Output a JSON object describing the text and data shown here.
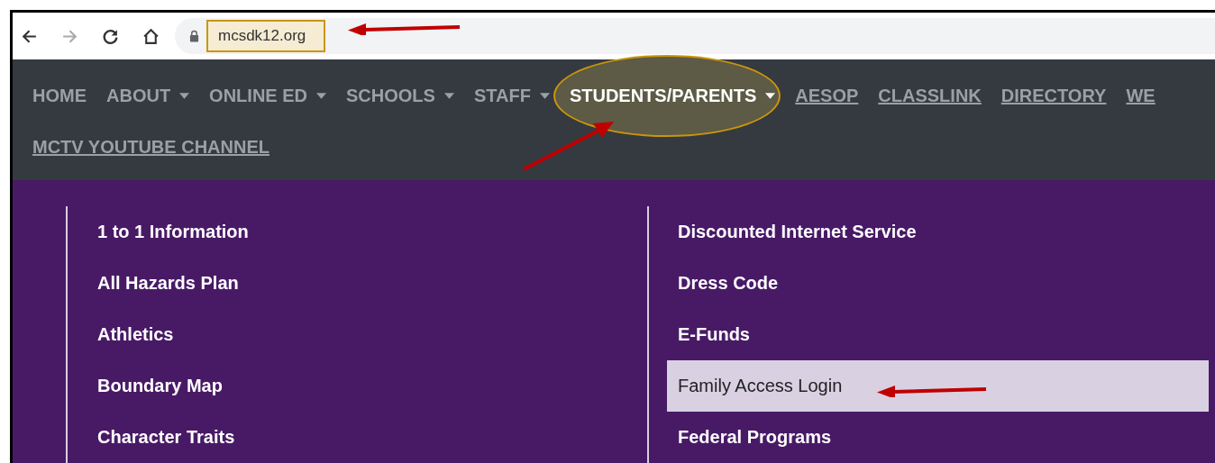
{
  "browser": {
    "back_disabled": false,
    "forward_disabled": true,
    "url": "mcsdk12.org"
  },
  "nav": {
    "rows": [
      [
        {
          "label": "HOME",
          "dropdown": false,
          "kind": "plain",
          "selected": false
        },
        {
          "label": "ABOUT",
          "dropdown": true,
          "kind": "plain",
          "selected": false
        },
        {
          "label": "ONLINE ED",
          "dropdown": true,
          "kind": "plain",
          "selected": false
        },
        {
          "label": "SCHOOLS",
          "dropdown": true,
          "kind": "plain",
          "selected": false
        },
        {
          "label": "STAFF",
          "dropdown": true,
          "kind": "plain",
          "selected": false
        },
        {
          "label": "STUDENTS/PARENTS",
          "dropdown": true,
          "kind": "plain",
          "selected": true
        },
        {
          "label": "AESOP",
          "dropdown": false,
          "kind": "link",
          "selected": false
        },
        {
          "label": "CLASSLINK",
          "dropdown": false,
          "kind": "link",
          "selected": false
        },
        {
          "label": "DIRECTORY",
          "dropdown": false,
          "kind": "link",
          "selected": false
        },
        {
          "label": "WE",
          "dropdown": false,
          "kind": "link",
          "selected": false
        }
      ],
      [
        {
          "label": "MCTV YOUTUBE CHANNEL",
          "dropdown": false,
          "kind": "link",
          "selected": false
        }
      ]
    ]
  },
  "menu": {
    "columns": [
      [
        {
          "label": "1 to 1 Information",
          "highlighted": false
        },
        {
          "label": "All Hazards Plan",
          "highlighted": false
        },
        {
          "label": "Athletics",
          "highlighted": false
        },
        {
          "label": "Boundary Map",
          "highlighted": false
        },
        {
          "label": "Character Traits",
          "highlighted": false
        }
      ],
      [
        {
          "label": "Discounted Internet Service",
          "highlighted": false
        },
        {
          "label": "Dress Code",
          "highlighted": false
        },
        {
          "label": "E-Funds",
          "highlighted": false
        },
        {
          "label": "Family Access Login",
          "highlighted": true
        },
        {
          "label": "Federal Programs",
          "highlighted": false
        }
      ]
    ]
  }
}
